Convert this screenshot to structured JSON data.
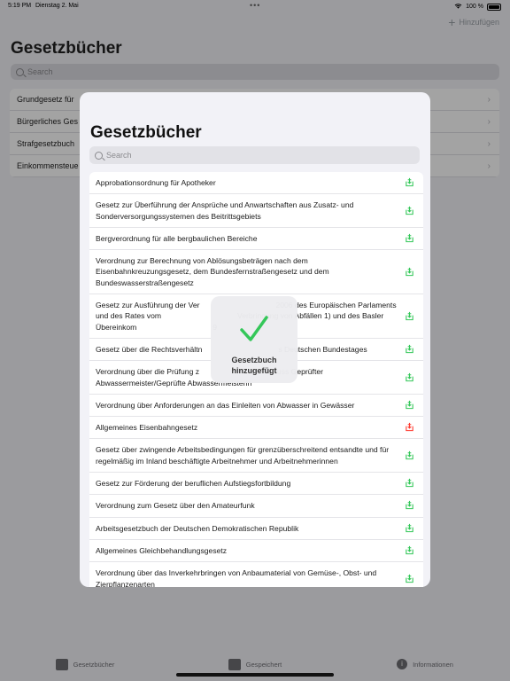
{
  "status_bar": {
    "time": "5:19 PM",
    "date": "Dienstag 2. Mai",
    "battery": "100 %"
  },
  "header": {
    "add_label": "Hinzufügen",
    "title": "Gesetzbücher",
    "search_placeholder": "Search"
  },
  "background_list": [
    {
      "label": "Grundgesetz für"
    },
    {
      "label": "Bürgerliches Ges"
    },
    {
      "label": "Strafgesetzbuch"
    },
    {
      "label": "Einkommensteue"
    }
  ],
  "modal": {
    "title": "Gesetzbücher",
    "search_placeholder": "Search",
    "items": [
      {
        "label": "Approbationsordnung für Apotheker",
        "state": "add"
      },
      {
        "label": "Gesetz zur Überführung der Ansprüche und Anwartschaften aus Zusatz- und Sonderversorgungssystemen des Beitrittsgebiets",
        "state": "add"
      },
      {
        "label": "Bergverordnung für alle bergbaulichen Bereiche",
        "state": "add"
      },
      {
        "label": "Verordnung zur Berechnung von Ablösungsbeträgen nach dem Eisenbahnkreuzungsgesetz, dem Bundesfernstraßengesetz und dem Bundeswasserstraßengesetz",
        "state": "add"
      },
      {
        "label": "Gesetz zur Ausführung der Ver                                    2006 des Europäischen Parlaments und des Rates vom                                    Verbringung von Abfällen 1) und des Basler Übereinkom                                    9",
        "state": "add"
      },
      {
        "label": "Gesetz über die Rechtsverhältn                                    s Deutschen Bundestages",
        "state": "add"
      },
      {
        "label": "Verordnung über die Prüfung z                                    luss Geprüfter Abwassermeister/Geprüfte Abwassermeisterin",
        "state": "add"
      },
      {
        "label": "Verordnung über Anforderungen an das Einleiten von Abwasser in Gewässer",
        "state": "add"
      },
      {
        "label": "Allgemeines Eisenbahngesetz",
        "state": "added"
      },
      {
        "label": "Gesetz über zwingende Arbeitsbedingungen für grenzüberschreitend entsandte und für regelmäßig im Inland beschäftigte Arbeitnehmer und Arbeitnehmerinnen",
        "state": "add"
      },
      {
        "label": "Gesetz zur Förderung der beruflichen Aufstiegsfortbildung",
        "state": "add"
      },
      {
        "label": "Verordnung zum Gesetz über den Amateurfunk",
        "state": "add"
      },
      {
        "label": "Arbeitsgesetzbuch der Deutschen Demokratischen Republik",
        "state": "add"
      },
      {
        "label": "Allgemeines Gleichbehandlungsgesetz",
        "state": "add"
      },
      {
        "label": "Verordnung über das Inverkehrbringen von Anbaumaterial von Gemüse-, Obst- und Zierpflanzenarten",
        "state": "add"
      }
    ]
  },
  "hud": {
    "message": "Gesetzbuch hinzugefügt"
  },
  "tabbar": [
    {
      "label": "Gesetzbücher"
    },
    {
      "label": "Gespeichert"
    },
    {
      "label": "Informationen"
    }
  ],
  "colors": {
    "add": "#34c759",
    "added": "#ff3b30",
    "accent": "#34c759"
  }
}
